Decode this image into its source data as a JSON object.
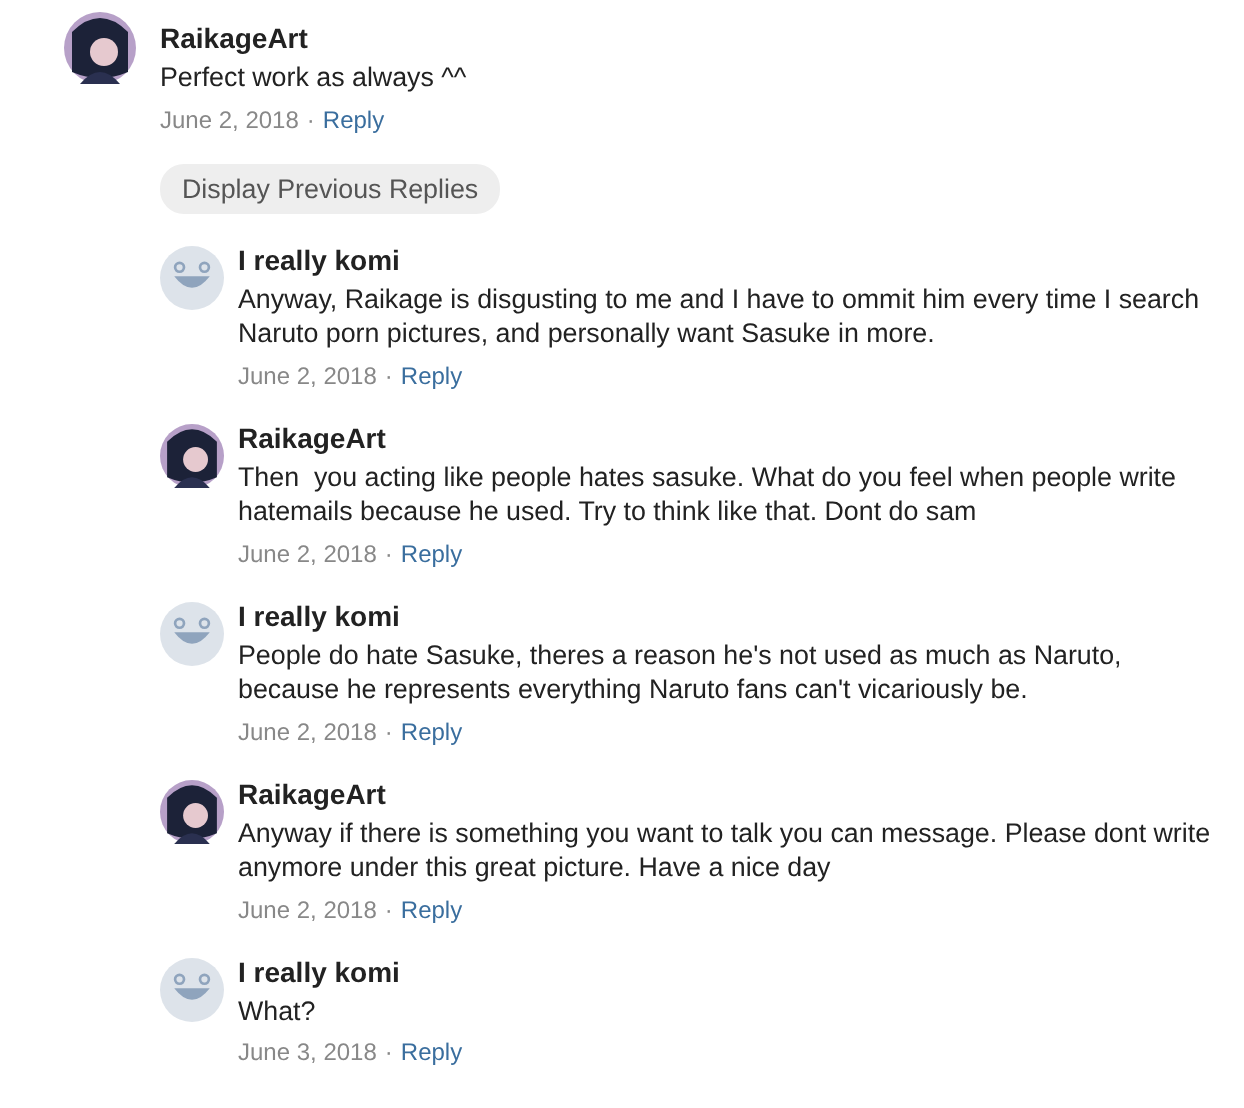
{
  "comment": {
    "avatar": {
      "kind": "figure"
    },
    "author": "RaikageArt",
    "text": "Perfect work as always ^^",
    "date": "June 2, 2018",
    "separator": "·",
    "reply": "Reply"
  },
  "previous_replies_button": "Display Previous Replies",
  "replies": [
    {
      "avatar": {
        "kind": "smiley"
      },
      "author": "I really komi",
      "text": "Anyway, Raikage is disgusting to me and I have to ommit him every time I search Naruto porn pictures, and personally want Sasuke in more.",
      "date": "June 2, 2018",
      "separator": "·",
      "reply": "Reply"
    },
    {
      "avatar": {
        "kind": "figure"
      },
      "author": "RaikageArt",
      "text": "Then  you acting like people hates sasuke. What do you feel when people write hatemails because he used. Try to think like that. Dont do sam",
      "date": "June 2, 2018",
      "separator": "·",
      "reply": "Reply"
    },
    {
      "avatar": {
        "kind": "smiley"
      },
      "author": "I really komi",
      "text": "People do hate Sasuke, theres a reason he's not used as much as Naruto, because he represents everything Naruto fans can't vicariously be.",
      "date": "June 2, 2018",
      "separator": "·",
      "reply": "Reply"
    },
    {
      "avatar": {
        "kind": "figure"
      },
      "author": "RaikageArt",
      "text": "Anyway if there is something you want to talk you can message. Please dont write anymore under this great picture. Have a nice day",
      "date": "June 2, 2018",
      "separator": "·",
      "reply": "Reply"
    },
    {
      "avatar": {
        "kind": "smiley"
      },
      "author": "I really komi",
      "text": "What?",
      "date": "June 3, 2018",
      "separator": "·",
      "reply": "Reply"
    }
  ]
}
